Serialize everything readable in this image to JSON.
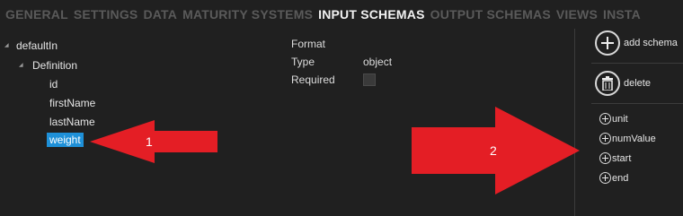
{
  "tabs": [
    {
      "label": "GENERAL",
      "active": false
    },
    {
      "label": "SETTINGS",
      "active": false
    },
    {
      "label": "DATA",
      "active": false
    },
    {
      "label": "MATURITY SYSTEMS",
      "active": false
    },
    {
      "label": "INPUT SCHEMAS",
      "active": true
    },
    {
      "label": "OUTPUT SCHEMAS",
      "active": false
    },
    {
      "label": "VIEWS",
      "active": false
    },
    {
      "label": "INSTA",
      "active": false
    }
  ],
  "tree": {
    "root": "defaultIn",
    "definition": "Definition",
    "fields": [
      "id",
      "firstName",
      "lastName",
      "weight"
    ],
    "selected": "weight"
  },
  "properties": {
    "format_label": "Format",
    "type_label": "Type",
    "type_value": "object",
    "required_label": "Required"
  },
  "actions": {
    "add_schema": "add schema",
    "delete": "delete"
  },
  "add_fields": [
    "unit",
    "numValue",
    "start",
    "end"
  ],
  "annotations": {
    "arrow1_label": "1",
    "arrow2_label": "2",
    "arrow_color": "#e41e25"
  },
  "colors": {
    "background": "#202020",
    "active_tab": "#f2f2f2",
    "inactive_tab": "#5a5a5a",
    "selection": "#1e90d8"
  }
}
